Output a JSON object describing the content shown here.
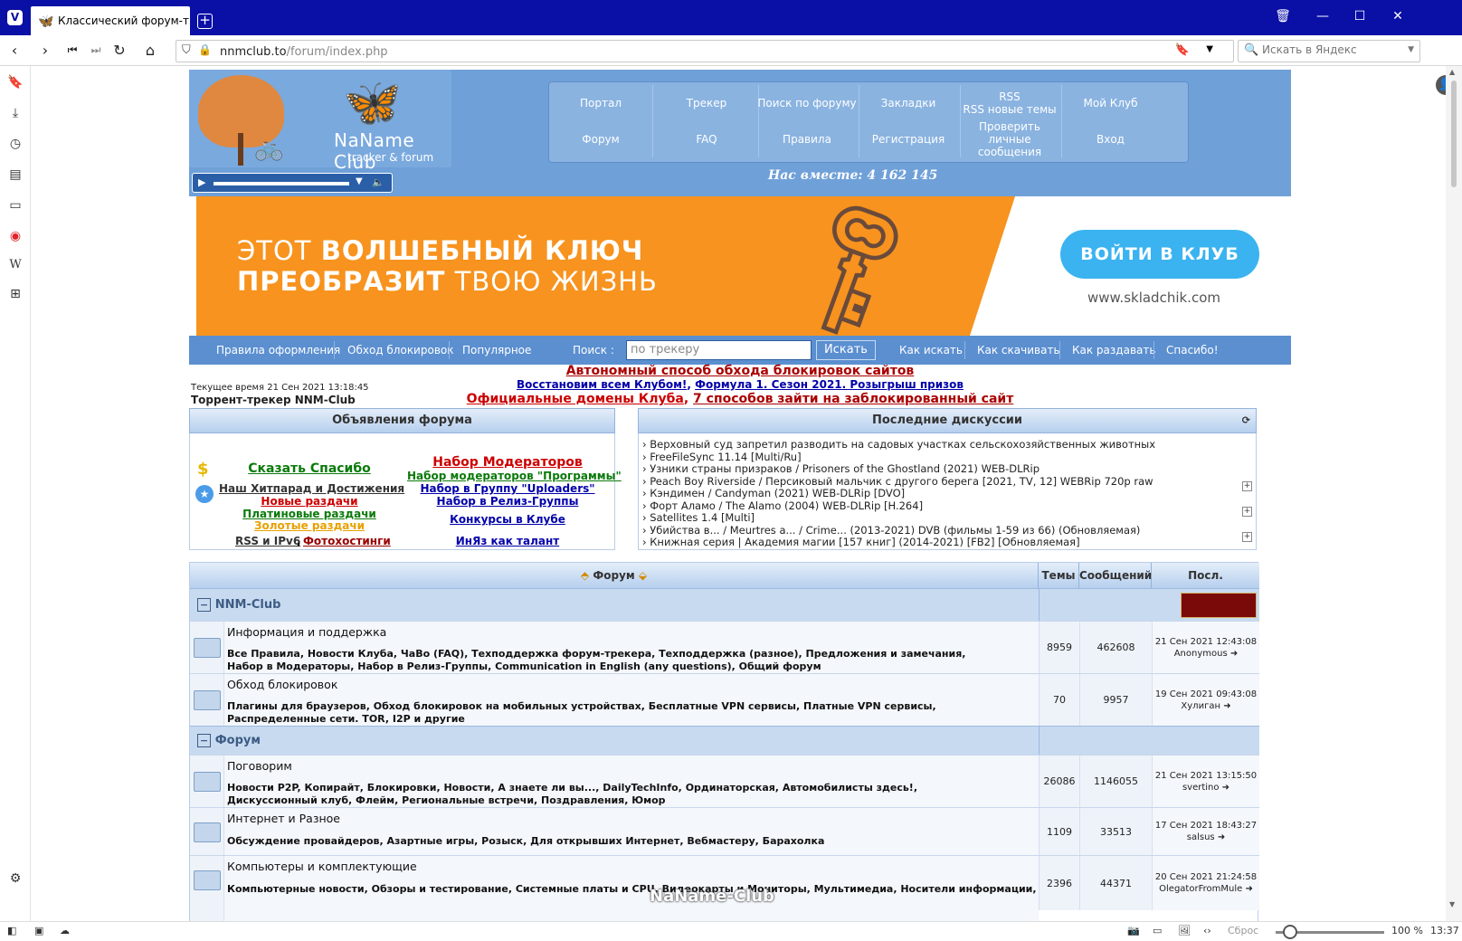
{
  "browser": {
    "tab_title": "Классический форум-трек",
    "url_host": "nnmclub.to",
    "url_path": "/forum/index.php",
    "search_placeholder": "Искать в Яндекс",
    "status_reset": "Сброс",
    "zoom": "100 %",
    "clock": "13:37"
  },
  "header": {
    "logo_name": "NaName Club",
    "logo_tagline": "tracker & forum",
    "together": "Нас вместе: 4 162 145",
    "menu": [
      {
        "label": "Портал"
      },
      {
        "label": "Трекер"
      },
      {
        "label": "Поиск по форуму"
      },
      {
        "label": "Закладки"
      },
      {
        "label": "RSS\nRSS новые темы"
      },
      {
        "label": "Мой Клуб"
      },
      {
        "label": "Форум"
      },
      {
        "label": "FAQ"
      },
      {
        "label": "Правила"
      },
      {
        "label": "Регистрация"
      },
      {
        "label": "Проверить личные сообщения"
      },
      {
        "label": "Вход"
      }
    ]
  },
  "banner": {
    "line1_light": "ЭТОТ ",
    "line1_bold": "ВОЛШЕБНЫЙ КЛЮЧ",
    "line2_bold": "ПРЕОБРАЗИТ",
    "line2_light": " ТВОЮ ЖИЗНЬ",
    "button": "ВОЙТИ В КЛУБ",
    "site": "www.skladchik.com"
  },
  "toolbar": {
    "links_left": [
      "Правила оформления",
      "Обход блокировок",
      "Популярное"
    ],
    "search_label": "Поиск :",
    "search_value": "по трекеру",
    "search_button": "Искать",
    "links_right": [
      "Как искать",
      "Как скачивать",
      "Как раздавать",
      "Спасибо!"
    ]
  },
  "info": {
    "current_time": "Текущее время 21 Сен 2021 13:18:45",
    "tracker_name": "Торрент-трекер NNM-Club",
    "notice1": "Автономный способ обхода блокировок сайтов",
    "notice2a": "Восстановим всем Клубом!",
    "notice2b": "Формула 1. Сезон 2021. Розыгрыш призов",
    "notice3a": "Официальные домены Клуба",
    "notice3b": "7 способов зайти на заблокированный сайт"
  },
  "announcements": {
    "title": "Объявления форума",
    "left": [
      {
        "text": "Сказать Спасибо",
        "color": "#0a7a0a"
      },
      {
        "text": "Наш Хитпарад и Достижения",
        "color": "#333333"
      },
      {
        "text": "Новые раздачи",
        "color": "#cc0000"
      },
      {
        "text": "Платиновые раздачи",
        "color": "#0a7a0a"
      },
      {
        "text": "Золотые раздачи",
        "color": "#e8a000"
      },
      {
        "text": "RSS и IPv6",
        "color": "#333333"
      },
      {
        "text": "Фотохостинги",
        "color": "#990000"
      }
    ],
    "right": [
      {
        "text": "Набор Модераторов",
        "color": "#cc0000"
      },
      {
        "text": "Набор модераторов \"Программы\"",
        "color": "#0a7a0a"
      },
      {
        "text": "Набор в Группу \"Uploaders\"",
        "color": "#0000aa"
      },
      {
        "text": "Набор в Релиз-Группы",
        "color": "#0000aa"
      },
      {
        "text": "Конкурсы в Клубе",
        "color": "#0000aa"
      },
      {
        "text": "ИнЯз как талант",
        "color": "#0000aa"
      }
    ]
  },
  "discussions": {
    "title": "Последние дискуссии",
    "items": [
      "› Верховный суд запретил разводить на садовых участках сельскохозяйственных животных",
      "› FreeFileSync 11.14 [Multi/Ru]",
      "› Узники страны призраков / Prisoners of the Ghostland (2021) WEB-DLRip",
      "› Peach Boy Riverside / Персиковый мальчик с другого берега [2021, TV, 12] WEBRip 720p raw",
      "› Кэндимен / Candyman (2021) WEB-DLRip [DVO]",
      "› Форт Аламо / The Alamo (2004) WEB-DLRip [H.264]",
      "› Satellites 1.4 [Multi]",
      "› Убийства в... / Meurtres a... / Crime... (2013-2021) DVB (фильмы 1-59 из 66) (Обновляемая)",
      "› Книжная серия | Академия магии [157 книг] (2014-2021) [FB2] [Обновляемая]"
    ]
  },
  "forum": {
    "head_forum": "Форум",
    "head_topics": "Темы",
    "head_posts": "Сообщений",
    "head_last": "Посл. сообщение",
    "cat1": "NNM-Club",
    "cat2": "Форум",
    "rows": [
      {
        "title": "Информация и поддержка",
        "sub1": "Все Правила,  Новости Клуба,  ЧаВо (FAQ),  Техподдержка форум-трекера,  Техподдержка (разное),  Предложения и замечания,",
        "sub2": "Набор в Модераторы,  Набор в Релиз-Группы,  Communication in English (any questions),  Общий форум",
        "topics": "8959",
        "posts": "462608",
        "last_date": "21 Сен 2021 12:43:08",
        "last_user": "Anonymous"
      },
      {
        "title": "Обход блокировок",
        "sub1": "Плагины для браузеров,  Обход блокировок на мобильных устройствах,  Бесплатные VPN сервисы,  Платные VPN сервисы,",
        "sub2": "Распределенные сети. TOR, I2P и другие",
        "topics": "70",
        "posts": "9957",
        "last_date": "19 Сен 2021 09:43:08",
        "last_user": "Хулиган"
      },
      {
        "title": "Поговорим",
        "sub1": "Новости P2P, Копирайт, Блокировки,  Новости,  А знаете ли вы...,  DailyTechInfo,  Ординаторская,  Автомобилисты здесь!,",
        "sub2": "Дискуссионный клуб,  Флейм,  Региональные встречи,  Поздравления,  Юмор",
        "topics": "26086",
        "posts": "1146055",
        "last_date": "21 Сен 2021 13:15:50",
        "last_user": "svertino"
      },
      {
        "title": "Интернет и Разное",
        "sub1": "Обсуждение провайдеров,  Азартные игры,  Розыск,  Для открывших Интернет,  Вебмастеру,  Барахолка",
        "sub2": "",
        "topics": "1109",
        "posts": "33513",
        "last_date": "17 Сен 2021 18:43:27",
        "last_user": "salsus"
      },
      {
        "title": "Компьютеры и комплектующие",
        "sub1": "Компьютерные новости,  Обзоры и тестирование,  Системные платы и CPU,  Видеокарты и Мониторы,  Мультимедиа,  Носители информации,",
        "sub2": "",
        "topics": "2396",
        "posts": "44371",
        "last_date": "20 Сен 2021 21:24:58",
        "last_user": "OlegatorFromMule"
      }
    ]
  },
  "watermark": "NaName-Club",
  "colors": {
    "titlebar": "#0a0fa6",
    "header_blue": "#6fa0d8",
    "banner_orange": "#f7931e",
    "button_blue": "#3ab3f0"
  }
}
